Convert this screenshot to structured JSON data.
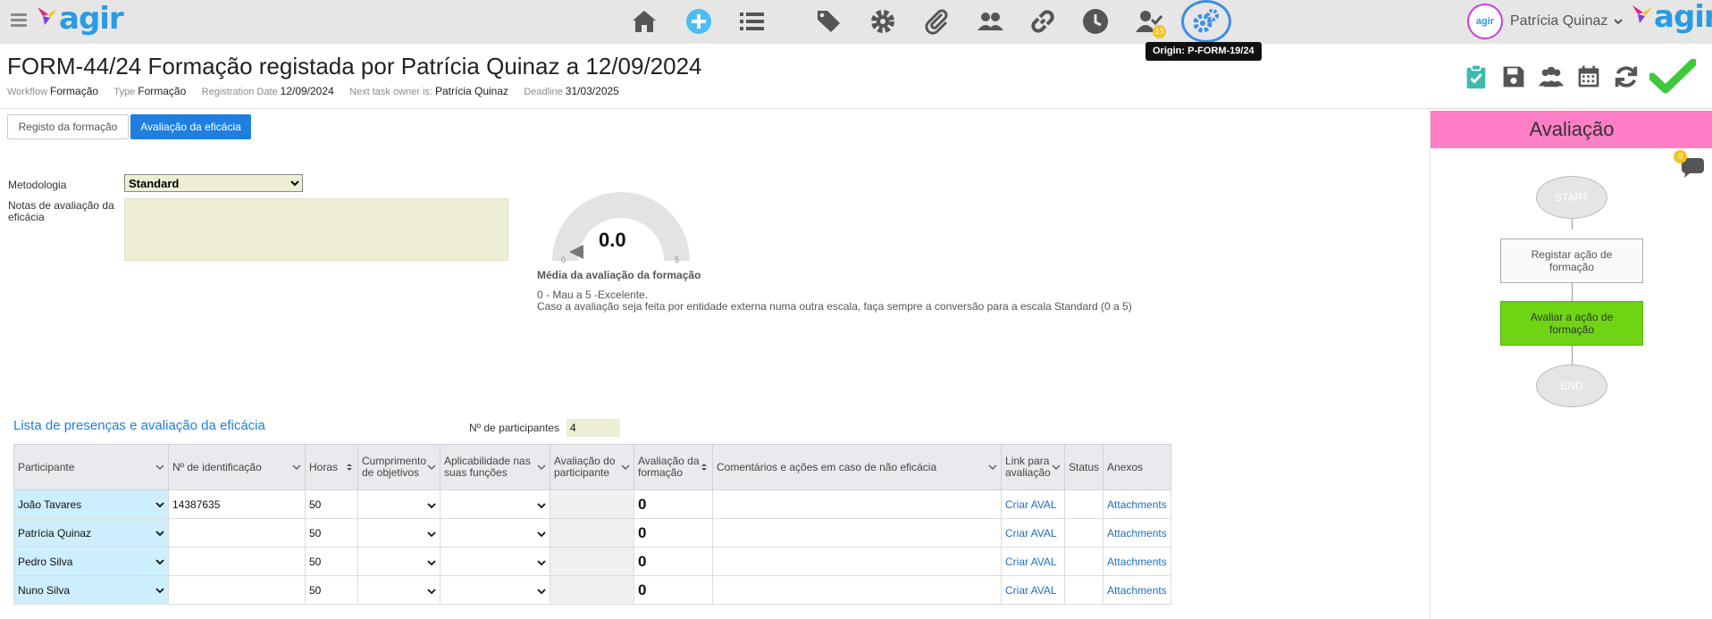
{
  "app": {
    "logo_text": "agir",
    "user_name": "Patrícia Quinaz",
    "avatar_text": "agir",
    "brand_color": "#2a9be0"
  },
  "nav_icons": [
    "home-icon",
    "add-icon",
    "list-icon",
    "tags-icon",
    "gear-icon",
    "attachment-icon",
    "users-icon",
    "link-icon",
    "clock-icon",
    "user-check-icon",
    "gears-icon"
  ],
  "badges": {
    "user_check": "13",
    "chat": "0"
  },
  "tooltip": "Origin: P-FORM-19/24",
  "header": {
    "title": "FORM-44/24 Formação registada por Patrícia Quinaz a 12/09/2024",
    "meta": [
      {
        "label": "Workflow",
        "value": "Formação"
      },
      {
        "label": "Type",
        "value": "Formação"
      },
      {
        "label": "Registration Date",
        "value": "12/09/2024"
      },
      {
        "label": "Next task owner is:",
        "value": "Patrícia Quinaz"
      },
      {
        "label": "Deadline",
        "value": "31/03/2025"
      }
    ]
  },
  "tabs": [
    "Registo da formação",
    "Avaliação da eficácia"
  ],
  "form": {
    "metodologia_label": "Metodologia",
    "metodologia_value": "Standard",
    "notas_label": "Notas de avaliação da eficácia",
    "notas_value": ""
  },
  "gauge": {
    "value": "0.0",
    "level": 0,
    "min": "0",
    "max": "5",
    "title": "Média da avaliação da formação",
    "note1": "0 - Mau a 5 -Excelente.",
    "note2": "Caso a avaliação seja feita por entidade externa numa outra escala, faça sempre a conversão para a escala Standard (0 a 5)"
  },
  "list": {
    "title": "Lista de presenças e avaliação da eficácia",
    "participants_label": "Nº de participantes",
    "participants_value": "4",
    "columns": [
      "Participante",
      "Nº de identificação",
      "Horas",
      "Cumprimento de objetivos",
      "Aplicabilidade nas suas funções",
      "Avaliação do participante",
      "Avaliação da formação",
      "Comentários e ações em caso de não eficácia",
      "Link para avaliação",
      "Status",
      "Anexos"
    ],
    "rows": [
      {
        "participante": "João Tavares",
        "id": "14387635",
        "horas": "50",
        "aval_formacao": "0",
        "link": "Criar AVAL",
        "anexos": "Attachments"
      },
      {
        "participante": "Patrícia Quinaz",
        "id": "",
        "horas": "50",
        "aval_formacao": "0",
        "link": "Criar AVAL",
        "anexos": "Attachments"
      },
      {
        "participante": "Pedro Silva",
        "id": "",
        "horas": "50",
        "aval_formacao": "0",
        "link": "Criar AVAL",
        "anexos": "Attachments"
      },
      {
        "participante": "Nuno Silva",
        "id": "",
        "horas": "50",
        "aval_formacao": "0",
        "link": "Criar AVAL",
        "anexos": "Attachments"
      }
    ]
  },
  "workflow": {
    "title": "Avaliação",
    "nodes": [
      "START",
      "Registar ação de formação",
      "Avaliar a ação de formação",
      "END"
    ],
    "active_color": "#6ed414",
    "header_color": "#ff7fc6"
  }
}
